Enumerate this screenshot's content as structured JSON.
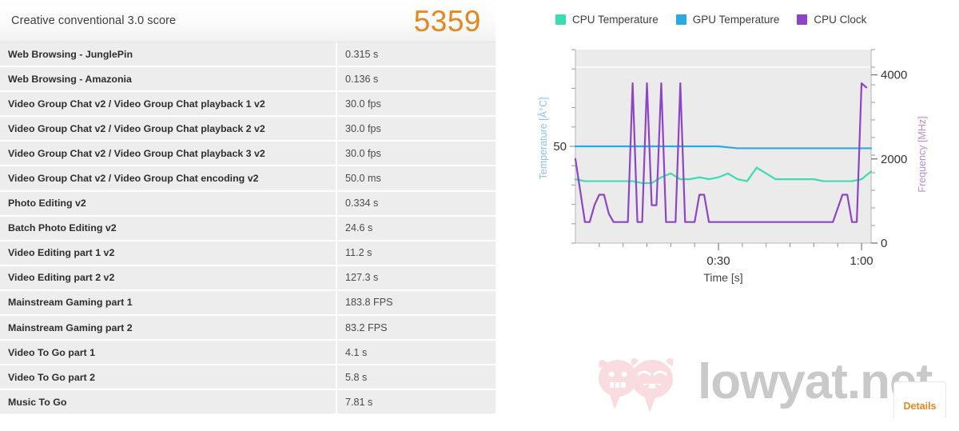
{
  "score_panel": {
    "title": "Creative conventional 3.0 score",
    "score": "5359",
    "score_color": "#e8861e"
  },
  "results": {
    "rows": [
      {
        "name": "Web Browsing - JunglePin",
        "value": "0.315 s"
      },
      {
        "name": "Web Browsing - Amazonia",
        "value": "0.136 s"
      },
      {
        "name": "Video Group Chat v2 / Video Group Chat playback 1 v2",
        "value": "30.0 fps"
      },
      {
        "name": "Video Group Chat v2 / Video Group Chat playback 2 v2",
        "value": "30.0 fps"
      },
      {
        "name": "Video Group Chat v2 / Video Group Chat playback 3 v2",
        "value": "30.0 fps"
      },
      {
        "name": "Video Group Chat v2 / Video Group Chat encoding v2",
        "value": "50.0 ms"
      },
      {
        "name": "Photo Editing v2",
        "value": "0.334 s"
      },
      {
        "name": "Batch Photo Editing v2",
        "value": "24.6 s"
      },
      {
        "name": "Video Editing part 1 v2",
        "value": "11.2 s"
      },
      {
        "name": "Video Editing part 2 v2",
        "value": "127.3 s"
      },
      {
        "name": "Mainstream Gaming part 1",
        "value": "183.8 FPS"
      },
      {
        "name": "Mainstream Gaming part 2",
        "value": "83.2 FPS"
      },
      {
        "name": "Video To Go part 1",
        "value": "4.1 s"
      },
      {
        "name": "Video To Go part 2",
        "value": "5.8 s"
      },
      {
        "name": "Music To Go",
        "value": "7.81 s"
      }
    ]
  },
  "details_button": {
    "label": "Details"
  },
  "watermark": {
    "text": "lowyat.net"
  },
  "chart_data": {
    "type": "line",
    "title": "",
    "xlabel": "Time [s]",
    "ylabel_left": "Temperature [Â°C]",
    "ylabel_right": "Frequency [MHz]",
    "x_tick_labels": [
      "0:30",
      "1:00"
    ],
    "x_tick_values": [
      30,
      60
    ],
    "xlim": [
      0,
      62
    ],
    "y_left_tick_labels": [
      "50"
    ],
    "y_left_tick_values": [
      50
    ],
    "ylim_left": [
      0,
      100
    ],
    "y_right_tick_labels": [
      "0",
      "2000",
      "4000"
    ],
    "y_right_tick_values": [
      0,
      2000,
      4000
    ],
    "ylim_right": [
      0,
      4600
    ],
    "grid": true,
    "legend_position": "top",
    "legend": [
      {
        "label": "CPU Temperature",
        "color": "#3ddcb0"
      },
      {
        "label": "GPU Temperature",
        "color": "#29abe2"
      },
      {
        "label": "CPU Clock",
        "color": "#8e44c8"
      }
    ],
    "series": [
      {
        "name": "CPU Temperature",
        "color": "#3ddcb0",
        "axis": "left",
        "unit": "°C",
        "x": [
          0,
          2,
          4,
          6,
          8,
          10,
          12,
          14,
          16,
          18,
          20,
          22,
          24,
          26,
          28,
          30,
          32,
          34,
          36,
          38,
          40,
          42,
          44,
          46,
          48,
          50,
          52,
          54,
          56,
          58,
          60,
          62
        ],
        "y": [
          33,
          32,
          32,
          32,
          32,
          32,
          32,
          31,
          31,
          34,
          36,
          33,
          33,
          34,
          33,
          34,
          36,
          33,
          32,
          39,
          36,
          33,
          33,
          33,
          33,
          33,
          32,
          32,
          32,
          32,
          33,
          37
        ]
      },
      {
        "name": "GPU Temperature",
        "color": "#29abe2",
        "axis": "left",
        "unit": "°C",
        "x": [
          0,
          10,
          20,
          30,
          34,
          40,
          50,
          60,
          62
        ],
        "y": [
          50,
          50,
          50,
          50,
          49,
          49,
          49,
          49,
          49
        ]
      },
      {
        "name": "CPU Clock",
        "color": "#8e44c8",
        "axis": "right",
        "unit": "MHz",
        "x": [
          0,
          1,
          2,
          3,
          4,
          5,
          6,
          7,
          8,
          9,
          10,
          11,
          12,
          13,
          14,
          15,
          16,
          17,
          18,
          19,
          20,
          21,
          22,
          23,
          24,
          25,
          26,
          27,
          28,
          29,
          30,
          31,
          32,
          33,
          34,
          35,
          36,
          38,
          40,
          42,
          44,
          46,
          48,
          50,
          52,
          54,
          56,
          57,
          58,
          59,
          60,
          61
        ],
        "y": [
          2000,
          1250,
          500,
          500,
          900,
          1150,
          1150,
          700,
          500,
          500,
          500,
          500,
          3800,
          500,
          500,
          3800,
          900,
          900,
          3800,
          500,
          500,
          500,
          3800,
          500,
          500,
          500,
          1150,
          1150,
          500,
          500,
          500,
          500,
          500,
          500,
          500,
          500,
          500,
          500,
          500,
          500,
          500,
          500,
          500,
          500,
          500,
          500,
          1150,
          1150,
          500,
          500,
          3800,
          3700
        ]
      }
    ]
  }
}
